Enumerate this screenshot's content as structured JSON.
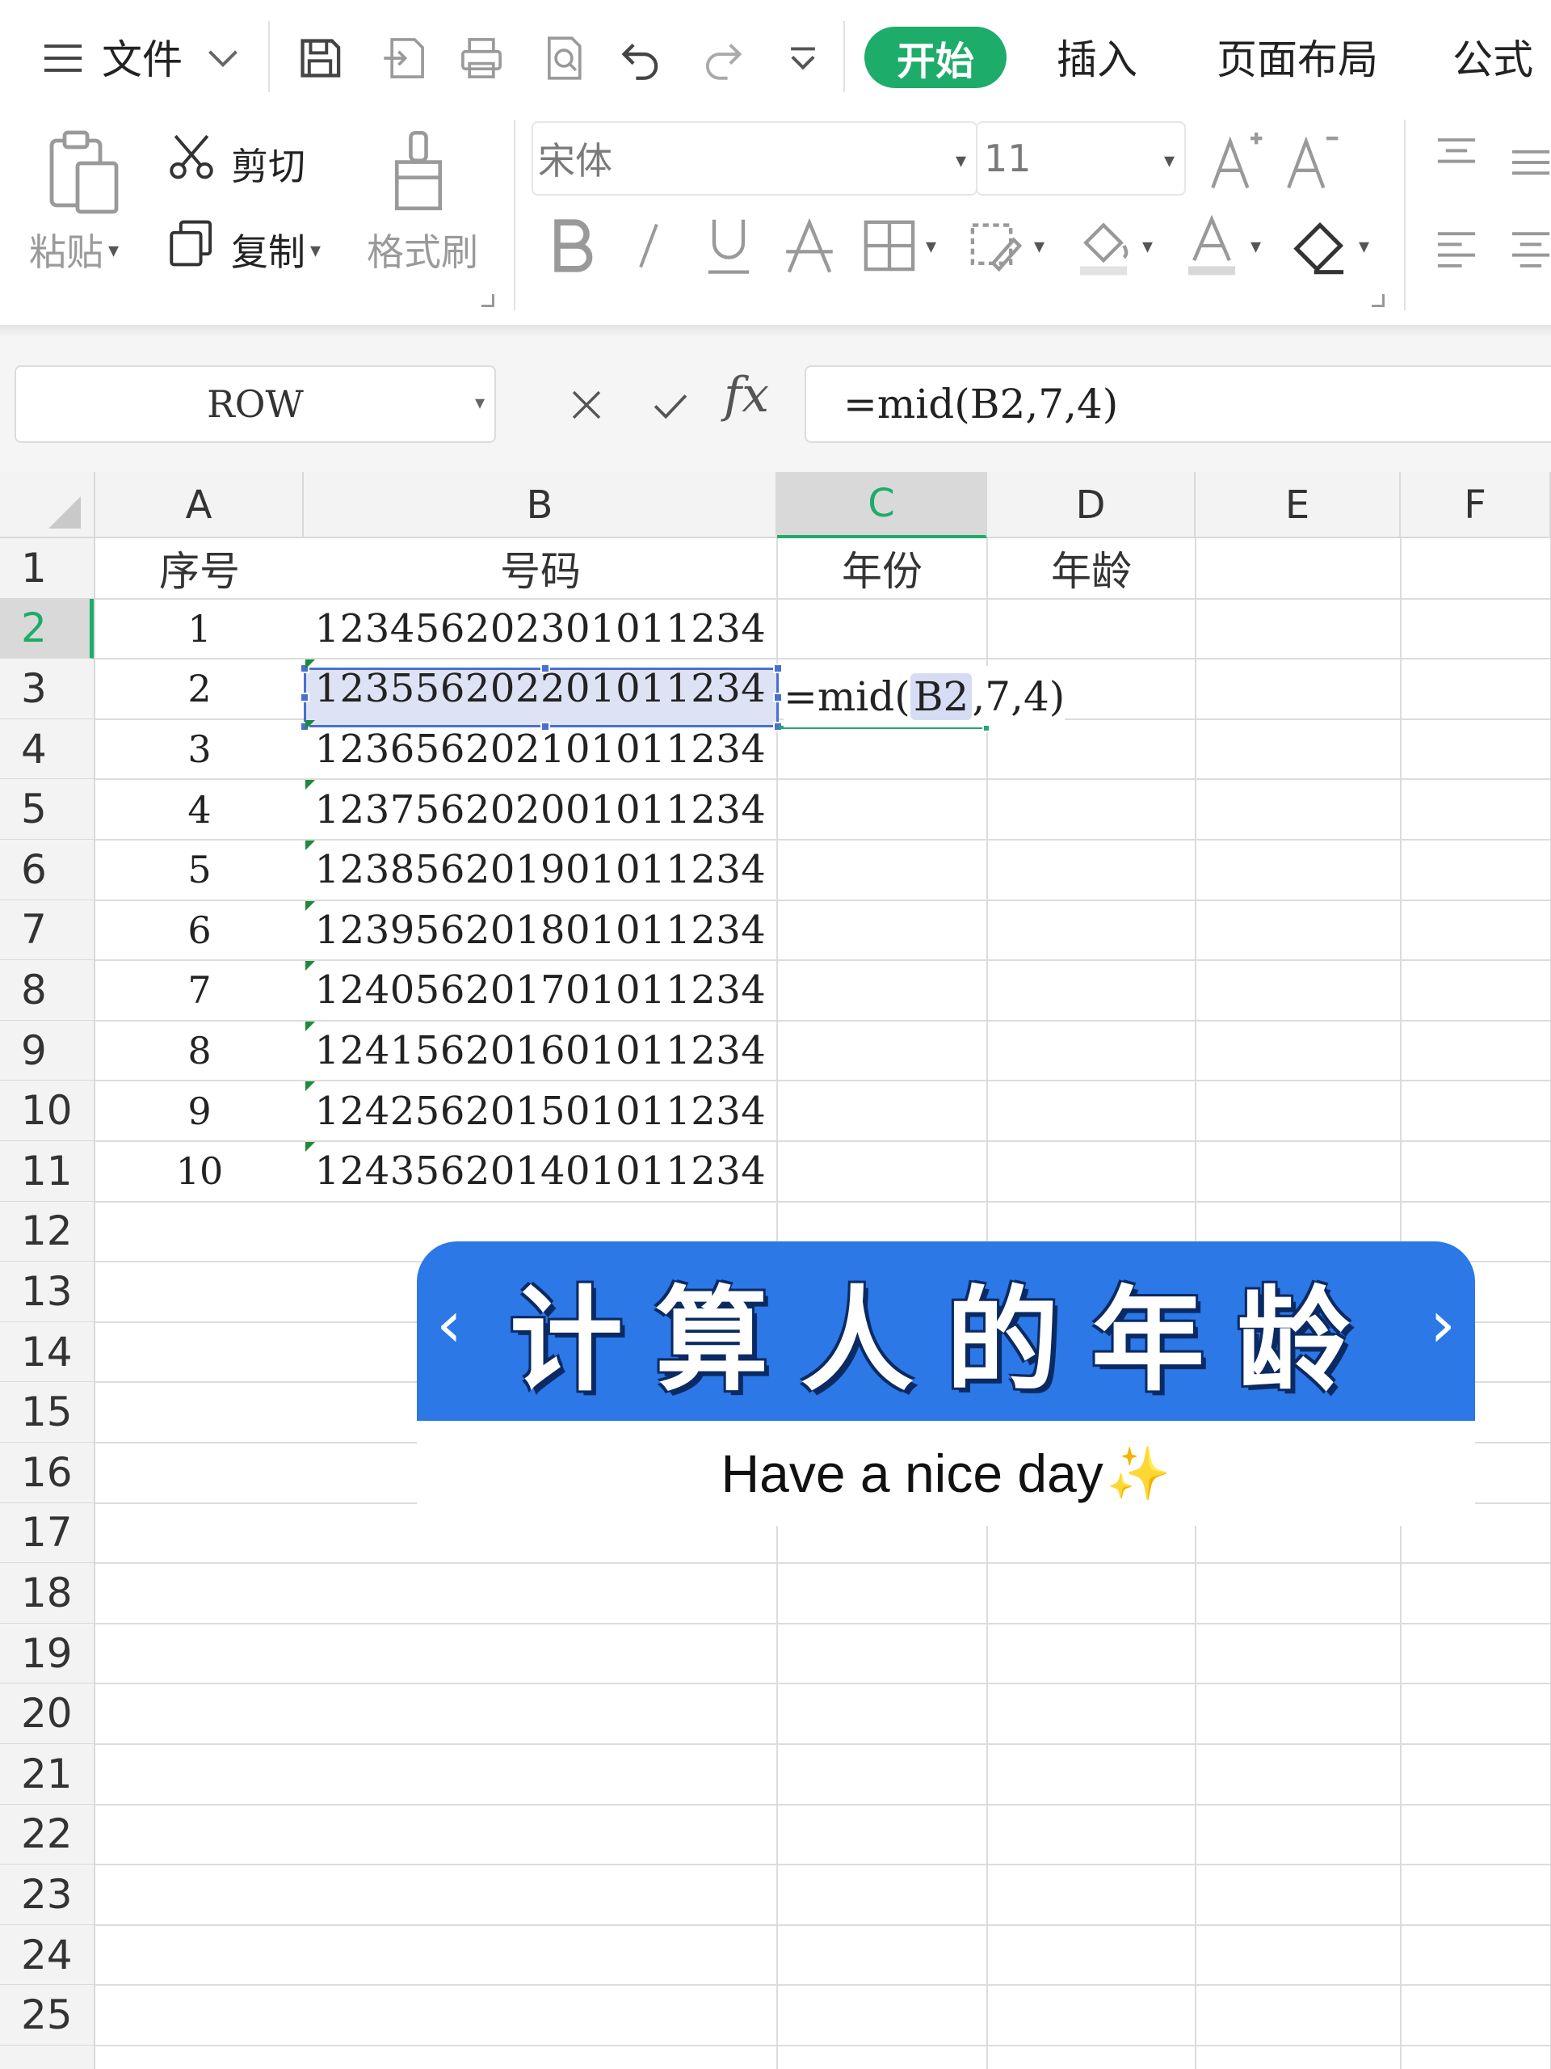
{
  "menubar": {
    "file_label": "文件",
    "tabs": [
      "开始",
      "插入",
      "页面布局",
      "公式"
    ],
    "active_tab": "开始"
  },
  "ribbon": {
    "paste_label": "粘贴",
    "cut_label": "剪切",
    "copy_label": "复制",
    "format_painter_label": "格式刷",
    "font_name": "宋体",
    "font_size": "11"
  },
  "formula_bar": {
    "name_box": "ROW",
    "fx_label": "fx",
    "formula": "=mid(B2,7,4)"
  },
  "grid": {
    "columns": [
      "A",
      "B",
      "C",
      "D",
      "E",
      "F"
    ],
    "active_column": "C",
    "active_row": "2",
    "row_numbers": [
      "1",
      "2",
      "3",
      "4",
      "5",
      "6",
      "7",
      "8",
      "9",
      "10",
      "11",
      "12",
      "13",
      "14",
      "15",
      "16",
      "17",
      "18",
      "19",
      "20",
      "21",
      "22",
      "23",
      "24",
      "25"
    ],
    "headers": {
      "a": "序号",
      "b": "号码",
      "c": "年份",
      "d": "年龄"
    },
    "rows": [
      {
        "seq": "1",
        "number": "123456202301011234"
      },
      {
        "seq": "2",
        "number": "123556202201011234"
      },
      {
        "seq": "3",
        "number": "123656202101011234"
      },
      {
        "seq": "4",
        "number": "123756202001011234"
      },
      {
        "seq": "5",
        "number": "123856201901011234"
      },
      {
        "seq": "6",
        "number": "123956201801011234"
      },
      {
        "seq": "7",
        "number": "124056201701011234"
      },
      {
        "seq": "8",
        "number": "124156201601011234"
      },
      {
        "seq": "9",
        "number": "124256201501011234"
      },
      {
        "seq": "10",
        "number": "124356201401011234"
      }
    ],
    "editing_cell": {
      "prefix": "=mid(",
      "ref": "B2",
      "suffix": ",7,4)"
    }
  },
  "overlay": {
    "title": "计算人的年龄",
    "prev_glyph": "‹",
    "next_glyph": "›",
    "subtitle": "Have a nice day",
    "subtitle_emoji": "✨"
  },
  "colors": {
    "accent_green": "#1eac6a",
    "selection_blue": "#4a6fd1",
    "banner_blue": "#2b78e6"
  }
}
